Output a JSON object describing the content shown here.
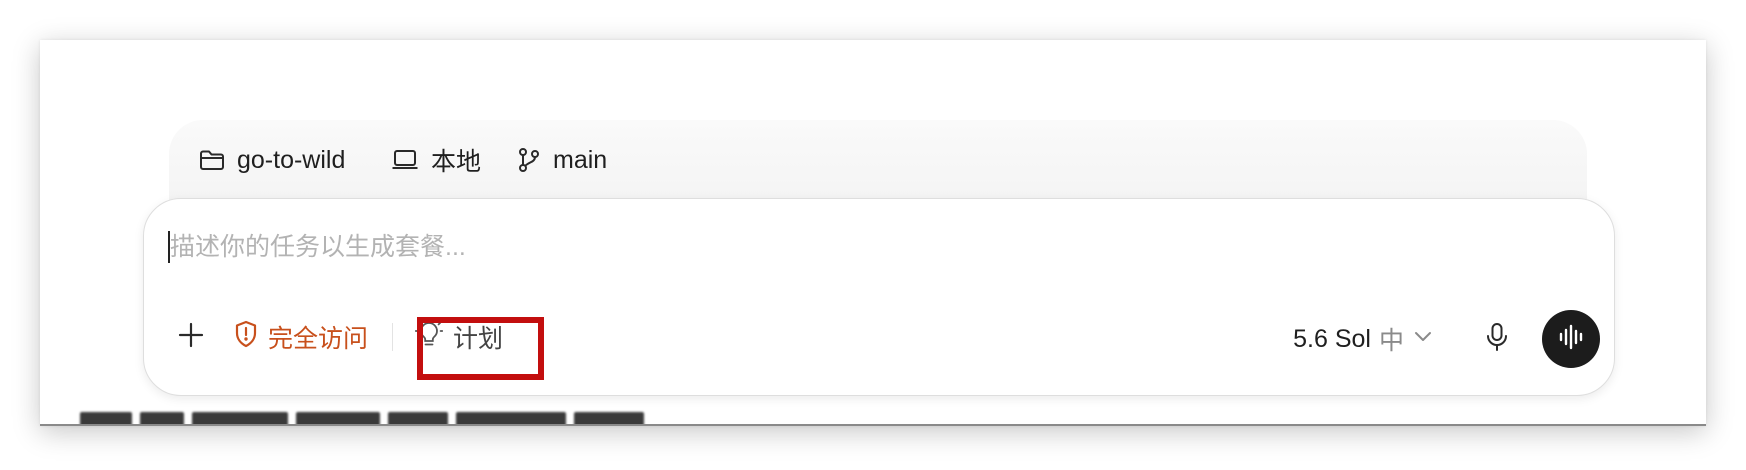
{
  "context": {
    "project": "go-to-wild",
    "environment": "本地",
    "branch": "main"
  },
  "composer": {
    "placeholder": "描述你的任务以生成套餐...",
    "add_label": "+",
    "access_label": "完全访问",
    "plan_label": "计划",
    "model_name": "5.6 Sol",
    "model_effort": "中"
  },
  "icons": {
    "project": "folder-icon",
    "environment": "laptop-icon",
    "branch": "git-branch-icon",
    "access": "shield-alert-icon",
    "plan": "lightbulb-icon",
    "model_dropdown": "chevron-down-icon",
    "mic": "microphone-icon",
    "voice": "waveform-icon"
  },
  "colors": {
    "access_accent": "#c8501c",
    "highlight_border": "#c30e0e",
    "voice_button_bg": "#1c1c1c"
  }
}
